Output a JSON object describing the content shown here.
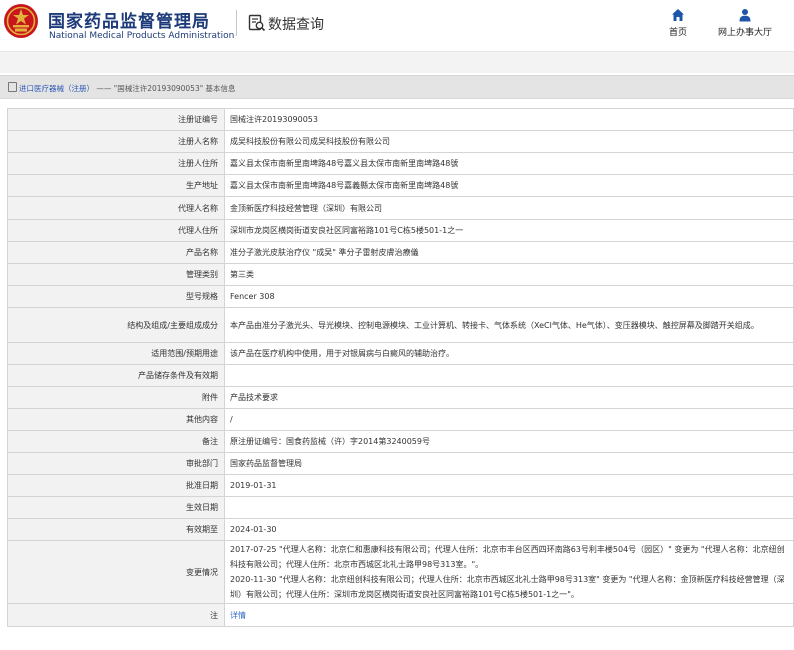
{
  "header": {
    "brand_cn": "国家药品监督管理局",
    "brand_en": "National Medical Products Administration",
    "section_title": "数据查询",
    "nav_home": "首页",
    "nav_hall": "网上办事大厅",
    "colors": {
      "brand": "#1d3b7a",
      "logo_red": "#c8161d",
      "logo_gold": "#e2b13c"
    }
  },
  "breadcrumb": {
    "part1": "进口医疗器械（注册）",
    "sep": " —— ",
    "part2": "\"国械注许20193090053\"",
    "part3": " 基本信息"
  },
  "rows": [
    {
      "key": "注册证编号",
      "value": "国械注许20193090053"
    },
    {
      "key": "注册人名称",
      "value": "成吴科技股份有限公司成吴科技股份有限公司"
    },
    {
      "key": "注册人住所",
      "value": "嘉义县太保市南新里南埤路48号嘉义县太保市南新里南埤路48號"
    },
    {
      "key": "生产地址",
      "value": "嘉义县太保市南新里南埤路48号嘉義縣太保市南新里南埤路48號"
    },
    {
      "key": "代理人名称",
      "value": "金顶新医疗科技经营管理（深圳）有限公司"
    },
    {
      "key": "代理人住所",
      "value": "深圳市龙岗区横岗街道安良社区同富裕路101号C栋5楼501-1之一"
    },
    {
      "key": "产品名称",
      "value": "准分子激光皮肤治疗仪 \"成吴\" 準分子雷射皮膚治療儀"
    },
    {
      "key": "管理类别",
      "value": "第三类"
    },
    {
      "key": "型号规格",
      "value": "Fencer 308"
    },
    {
      "key": "结构及组成/主要组成成分",
      "value": "本产品由准分子激光头、导光模块、控制电源模块、工业计算机、转接卡、气体系统（XeCl气体、He气体）、变压器模块、触控屏幕及脚踏开关组成。"
    },
    {
      "key": "适用范围/预期用途",
      "value": "该产品在医疗机构中使用，用于对银屑病与白癜风的辅助治疗。"
    },
    {
      "key": "产品储存条件及有效期",
      "value": ""
    },
    {
      "key": "附件",
      "value": "产品技术要求"
    },
    {
      "key": "其他内容",
      "value": "/"
    },
    {
      "key": "备注",
      "value": "原注册证编号：国食药监械（许）字2014第3240059号"
    },
    {
      "key": "审批部门",
      "value": "国家药品监督管理局"
    },
    {
      "key": "批准日期",
      "value": "2019-01-31"
    },
    {
      "key": "生效日期",
      "value": ""
    },
    {
      "key": "有效期至",
      "value": "2024-01-30"
    },
    {
      "key": "变更情况",
      "value": "2017-07-25 \"代理人名称：北京仁和惠康科技有限公司；代理人住所：北京市丰台区西四环南路63号利丰楼504号（园区）\" 变更为 \"代理人名称：北京纽创科技有限公司；代理人住所：北京市西城区北礼士路甲98号313室。\"。\n2020-11-30 \"代理人名称：北京纽创科技有限公司；代理人住所：北京市西城区北礼士路甲98号313室\" 变更为 \"代理人名称：金顶新医疗科技经营管理（深圳）有限公司；代理人住所：深圳市龙岗区横岗街道安良社区同富裕路101号C栋5楼501-1之一\"。"
    },
    {
      "key": "注",
      "value": "详情",
      "is_link": true
    }
  ]
}
